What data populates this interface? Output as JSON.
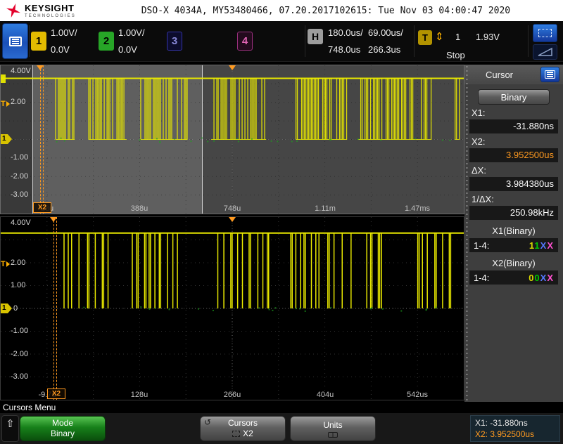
{
  "colors": {
    "cursor_accent": "#ff9a20",
    "trigger": "#ffb000",
    "waveform": "#e8e800",
    "channel_colors": [
      "#d8d800",
      "#00c800",
      "#5578ff",
      "#ff50d0"
    ],
    "ch1_marker": "#d8c300"
  },
  "header": {
    "brand": "KEYSIGHT",
    "brand_sub": "TECHNOLOGIES",
    "title": "DSO-X 4034A, MY53480466, 07.20.2017102615: Tue Nov 03 04:00:47 2020"
  },
  "toolbar": {
    "channels": [
      {
        "num": "1",
        "vdiv": "1.00V/",
        "offset": "0.0V"
      },
      {
        "num": "2",
        "vdiv": "1.00V/",
        "offset": "0.0V"
      },
      {
        "num": "3"
      },
      {
        "num": "4"
      }
    ],
    "horizontal": {
      "badge": "H",
      "main_scale": "180.0us/",
      "main_delay": "748.0us",
      "zoom_scale": "69.00us/",
      "zoom_delay": "266.3us"
    },
    "trigger": {
      "badge": "T",
      "updown_glyph": "⇕",
      "source": "1",
      "level": "1.93V",
      "run_state": "Stop"
    }
  },
  "scope": {
    "top": {
      "vlabels": [
        "4.00V",
        "2.00",
        "-1.00",
        "-2.00",
        "-3.00"
      ],
      "tlabels": [
        "28u",
        "388u",
        "748u",
        "1.11m",
        "1.47ms"
      ],
      "trig_marker": "T",
      "ch_marker": "1",
      "cursor_flag": "X2"
    },
    "bottom": {
      "vlabels": [
        "4.00V",
        "2.00",
        "1.00",
        "0",
        "-1.00",
        "-2.00",
        "-3.00"
      ],
      "tlabels": [
        "-9.7u",
        "128u",
        "266u",
        "404u",
        "542us"
      ],
      "trig_marker": "T",
      "ch_marker": "1",
      "cursor_flag": "X2"
    }
  },
  "sidebar": {
    "title": "Cursor",
    "mode_button": "Binary",
    "rows": [
      {
        "label": "X1:",
        "value": "-31.880ns"
      },
      {
        "label": "X2:",
        "value": "3.952500us"
      },
      {
        "label": "ΔX:",
        "value": "3.984380us"
      },
      {
        "label": "1/ΔX:",
        "value": "250.98kHz"
      }
    ],
    "binary_groups": [
      {
        "title": "X1(Binary)",
        "range": "1-4:",
        "digits": [
          "1",
          "1",
          "X",
          "X"
        ]
      },
      {
        "title": "X2(Binary)",
        "range": "1-4:",
        "digits": [
          "0",
          "0",
          "X",
          "X"
        ]
      }
    ]
  },
  "bottom": {
    "menu_label": "Cursors Menu",
    "back_glyph": "⇧",
    "softkeys": {
      "mode": {
        "line1": "Mode",
        "line2": "Binary"
      },
      "cursors": {
        "line1": "Cursors",
        "line2": "X2",
        "return_glyph": "↺"
      },
      "units": {
        "line1": "Units"
      }
    },
    "readout": {
      "x1": "X1: -31.880ns",
      "x2": "X2: 3.952500us"
    }
  }
}
